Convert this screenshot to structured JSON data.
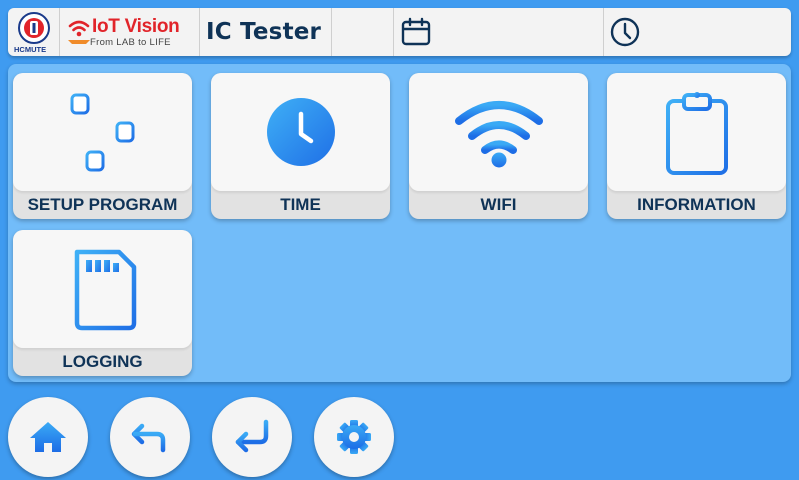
{
  "header": {
    "logo_left_text": "HCMUTE",
    "brand_name": "IoT Vision",
    "brand_tagline": "From LAB to LIFE",
    "title": "IC Tester",
    "date_value": "",
    "time_value": "",
    "icons": {
      "date": "calendar-icon",
      "time": "clock-icon"
    }
  },
  "tiles": [
    {
      "label": "SETUP PROGRAM",
      "icon": "sliders-icon"
    },
    {
      "label": "TIME",
      "icon": "clock-icon"
    },
    {
      "label": "WIFI",
      "icon": "wifi-icon"
    },
    {
      "label": "INFORMATION",
      "icon": "clipboard-icon"
    },
    {
      "label": "LOGGING",
      "icon": "sd-card-icon"
    }
  ],
  "nav": [
    {
      "icon": "home-icon"
    },
    {
      "icon": "back-arrow-icon"
    },
    {
      "icon": "enter-icon"
    },
    {
      "icon": "gear-icon"
    }
  ],
  "colors": {
    "background": "#3f9bf0",
    "panel": "#72bcf9",
    "accent": "#2a8ef0",
    "text": "#0f3357"
  }
}
